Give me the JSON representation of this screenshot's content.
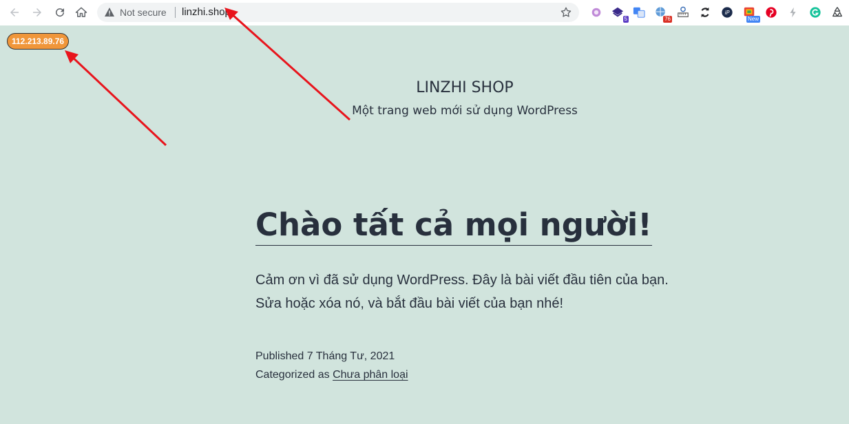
{
  "browser": {
    "security_label": "Not secure",
    "url": "linzhi.shop",
    "nav_icons": [
      "back-icon",
      "forward-icon",
      "reload-icon",
      "home-icon"
    ],
    "extensions": [
      {
        "name": "purple-circle-extension-icon",
        "badge": ""
      },
      {
        "name": "stack-extension-icon",
        "badge": "5"
      },
      {
        "name": "translate-extension-icon",
        "badge": ""
      },
      {
        "name": "globe-extension-icon",
        "badge": "76"
      },
      {
        "name": "ruler-extension-icon",
        "badge": ""
      },
      {
        "name": "sync-extension-icon",
        "badge": ""
      },
      {
        "name": "ip-extension-icon",
        "badge": ""
      },
      {
        "name": "color-extension-icon",
        "badge": "New"
      },
      {
        "name": "pinterest-extension-icon",
        "badge": ""
      },
      {
        "name": "bolt-extension-icon",
        "badge": ""
      },
      {
        "name": "grammarly-extension-icon",
        "badge": ""
      },
      {
        "name": "recycle-extension-icon",
        "badge": ""
      }
    ]
  },
  "ip_badge": "112.213.89.76",
  "site": {
    "title": "LINZHI SHOP",
    "description": "Một trang web mới sử dụng WordPress"
  },
  "post": {
    "title": "Chào tất cả mọi người!",
    "body_line1": "Cảm ơn vì đã sử dụng WordPress. Đây là bài viết đầu tiên của bạn.",
    "body_line2": "Sửa hoặc xóa nó, và bắt đầu bài viết của bạn nhé!",
    "published": "Published 7 Tháng Tư, 2021",
    "categorized_prefix": "Categorized as",
    "category": "Chưa phân loại"
  },
  "colors": {
    "background": "#d1e4dd",
    "text": "#28303d",
    "ip_badge_bg": "#f0963a",
    "arrow": "#e8141c"
  }
}
